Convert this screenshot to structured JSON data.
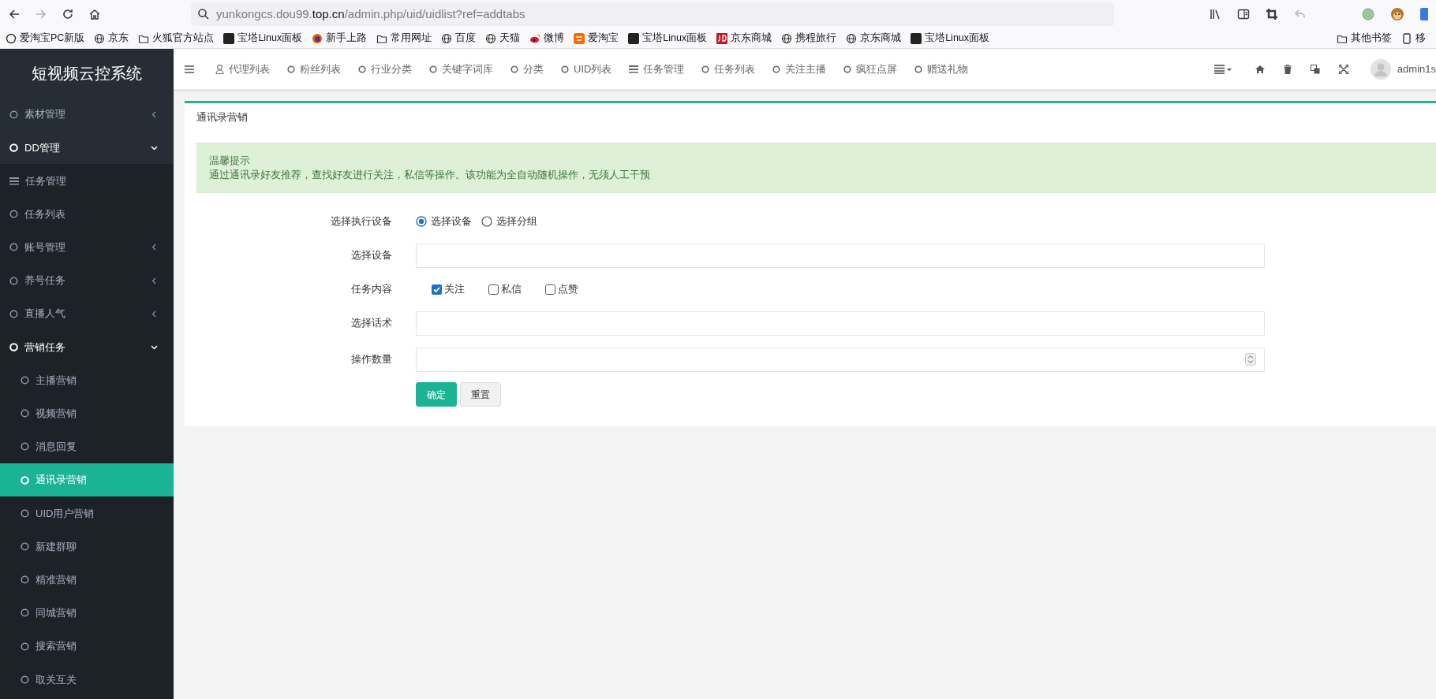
{
  "browser": {
    "back": {
      "disabled": false
    },
    "forward": {
      "disabled": true
    },
    "url": {
      "subdomain": "yunkongcs.dou99.",
      "domain": "top.cn",
      "path": "/admin.php/uid/uidlist?ref=addtabs"
    },
    "bookmarks": [
      {
        "label": "爱淘宝PC新版",
        "kind": "taobao-round"
      },
      {
        "label": "京东",
        "kind": "globe"
      },
      {
        "label": "火狐官方站点",
        "kind": "folder"
      },
      {
        "label": "宝塔Linux面板",
        "kind": "bt"
      },
      {
        "label": "新手上路",
        "kind": "firefox"
      },
      {
        "label": "常用网址",
        "kind": "folder"
      },
      {
        "label": "百度",
        "kind": "globe"
      },
      {
        "label": "天猫",
        "kind": "globe"
      },
      {
        "label": "微博",
        "kind": "weibo"
      },
      {
        "label": "爱淘宝",
        "kind": "taobao"
      },
      {
        "label": "宝塔Linux面板",
        "kind": "bt"
      },
      {
        "label": "京东商城",
        "kind": "jd"
      },
      {
        "label": "携程旅行",
        "kind": "globe"
      },
      {
        "label": "京东商城",
        "kind": "globe"
      },
      {
        "label": "宝塔Linux面板",
        "kind": "bt"
      }
    ],
    "bookmarks_right": [
      {
        "label": "其他书签",
        "kind": "folder"
      },
      {
        "label": "移",
        "kind": "mobile"
      }
    ]
  },
  "sidebar": {
    "title": "短视频云控系统",
    "items": [
      {
        "label": "素材管理",
        "kind": "folder",
        "expanded": false
      },
      {
        "label": "DD管理",
        "kind": "folder",
        "expanded": true,
        "children": [
          {
            "label": "任务管理",
            "kind": "list-link",
            "selected": false
          },
          {
            "label": "任务列表",
            "kind": "link",
            "selected": false
          },
          {
            "label": "账号管理",
            "kind": "folder",
            "expanded": false
          },
          {
            "label": "养号任务",
            "kind": "folder",
            "expanded": false
          },
          {
            "label": "直播人气",
            "kind": "folder",
            "expanded": false
          },
          {
            "label": "营销任务",
            "kind": "folder",
            "expanded": true,
            "children": [
              {
                "label": "主播营销",
                "kind": "link",
                "selected": false
              },
              {
                "label": "视频营销",
                "kind": "link",
                "selected": false
              },
              {
                "label": "消息回复",
                "kind": "link",
                "selected": false
              },
              {
                "label": "通讯录营销",
                "kind": "link",
                "selected": true
              },
              {
                "label": "UID用户营销",
                "kind": "link",
                "selected": false
              },
              {
                "label": "新建群聊",
                "kind": "link",
                "selected": false
              },
              {
                "label": "精准营销",
                "kind": "link",
                "selected": false
              },
              {
                "label": "同城营销",
                "kind": "link",
                "selected": false
              },
              {
                "label": "搜索营销",
                "kind": "link",
                "selected": false
              },
              {
                "label": "取关互关",
                "kind": "link",
                "selected": false
              }
            ]
          }
        ]
      }
    ]
  },
  "top_nav": {
    "tabs": [
      {
        "label": "代理列表",
        "kind": "person-link"
      },
      {
        "label": "粉丝列表",
        "kind": "link"
      },
      {
        "label": "行业分类",
        "kind": "link"
      },
      {
        "label": "关键字词库",
        "kind": "link"
      },
      {
        "label": "分类",
        "kind": "link"
      },
      {
        "label": "UID列表",
        "kind": "link"
      },
      {
        "label": "任务管理",
        "kind": "list-link"
      },
      {
        "label": "任务列表",
        "kind": "link"
      },
      {
        "label": "关注主播",
        "kind": "link"
      },
      {
        "label": "疯狂点屏",
        "kind": "link"
      },
      {
        "label": "赠送礼物",
        "kind": "link"
      }
    ],
    "user": "admin1s"
  },
  "panel": {
    "title": "通讯录营销",
    "notice": {
      "title": "温馨提示",
      "text": "通过通讯录好友推荐，查找好友进行关注，私信等操作。该功能为全自动随机操作，无须人工干预"
    },
    "form": {
      "rows": [
        {
          "label": "选择执行设备",
          "kind": "radios",
          "options": [
            {
              "label": "选择设备",
              "selected": true
            },
            {
              "label": "选择分组",
              "selected": false
            }
          ]
        },
        {
          "label": "选择设备",
          "kind": "text"
        },
        {
          "label": "任务内容",
          "kind": "checkboxes",
          "options": [
            {
              "label": "关注",
              "checked": true
            },
            {
              "label": "私信",
              "checked": false
            },
            {
              "label": "点赞",
              "checked": false
            }
          ]
        },
        {
          "label": "选择话术",
          "kind": "text"
        },
        {
          "label": "操作数量",
          "kind": "number"
        }
      ],
      "buttons": [
        {
          "label": "确定",
          "kind": "primary"
        },
        {
          "label": "重置",
          "kind": "default"
        }
      ]
    }
  }
}
